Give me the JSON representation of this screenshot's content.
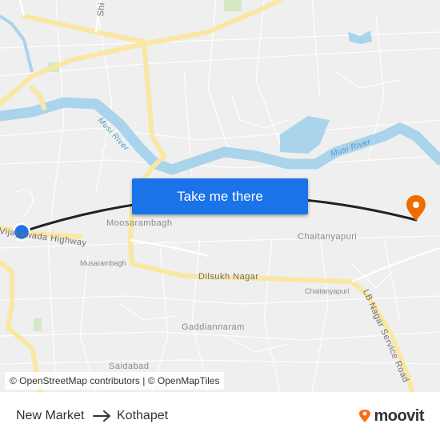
{
  "map": {
    "places": {
      "moosarambagh": "Moosarambagh",
      "musarambagh": "Musarambagh",
      "chaitanyapuri": "Chaitanyapuri",
      "chaitanyapuri_small": "Chaitanyapuri",
      "gaddiannaram": "Gaddiannaram",
      "saidabad": "Saidabad"
    },
    "roads": {
      "highway": "Vijayawada Highway",
      "dilsukh": "Dilsukh Nagar",
      "lb_nagar": "LB Nagar Service Road",
      "top_left": "Shi"
    },
    "rivers": {
      "musi_left": "Musi River",
      "musi_right": "Musi River"
    },
    "colors": {
      "background": "#efefef",
      "road_major": "#f9e7a3",
      "water": "#aad3ec",
      "route_line": "#222222",
      "origin_marker": "#1a73e8",
      "destination_marker": "#ef6c00",
      "button": "#1a73e8",
      "brand_orange": "#ff6a13"
    },
    "origin_marker_icon": "blue-location-dot",
    "destination_marker_icon": "orange-map-pin"
  },
  "cta": {
    "label": "Take me there"
  },
  "attribution": {
    "text": "© OpenStreetMap contributors | © OpenMapTiles"
  },
  "footer": {
    "from": "New Market",
    "to": "Kothapet",
    "arrow_icon": "right-arrow",
    "brand": "moovit",
    "brand_icon": "moovit-logo"
  }
}
